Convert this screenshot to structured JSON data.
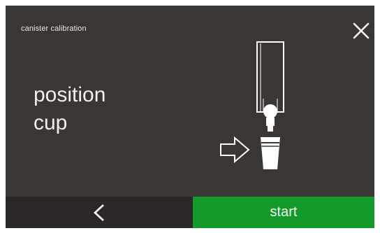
{
  "header": {
    "title": "canister calibration",
    "close_icon": "close-icon"
  },
  "main": {
    "instruction_lines": [
      "position",
      "cup"
    ],
    "illustration_icons": [
      "canister-icon",
      "arrow-right-icon",
      "cup-icon"
    ]
  },
  "footer": {
    "back_icon": "chevron-left-icon",
    "start_label": "start"
  },
  "colors": {
    "screen_background": "#3a3634",
    "back_button": "#2a2726",
    "start_button": "#149a2a",
    "text": "#f2f0ee"
  }
}
